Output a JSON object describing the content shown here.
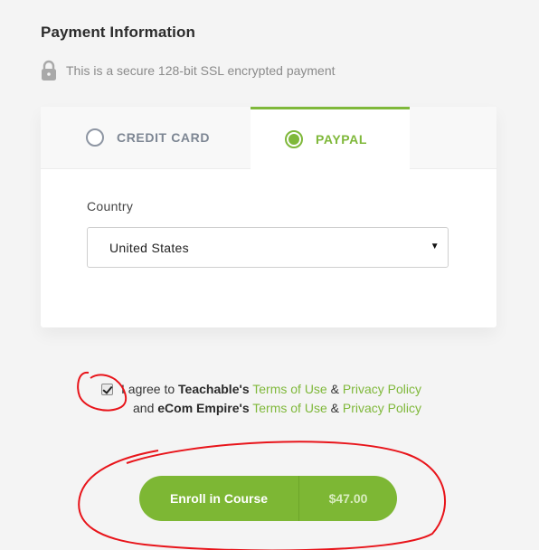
{
  "header": {
    "title": "Payment Information",
    "secure_text": "This is a secure 128-bit SSL encrypted payment"
  },
  "tabs": [
    {
      "label": "CREDIT CARD",
      "selected": false
    },
    {
      "label": "PAYPAL",
      "selected": true
    }
  ],
  "form": {
    "country_label": "Country",
    "country_value": "United States"
  },
  "agreement": {
    "checked": true,
    "line1_prefix": "I agree to",
    "line1_org": "Teachable's",
    "line1_terms": "Terms of Use",
    "line1_amp": "&",
    "line1_privacy": "Privacy Policy",
    "line2_prefix": "and",
    "line2_org": "eCom Empire's",
    "line2_terms": "Terms of Use",
    "line2_amp": "&",
    "line2_privacy": "Privacy Policy"
  },
  "enroll": {
    "label": "Enroll in Course",
    "price": "$47.00"
  },
  "colors": {
    "accent": "#7fb83a",
    "annotation": "#e8141a"
  }
}
